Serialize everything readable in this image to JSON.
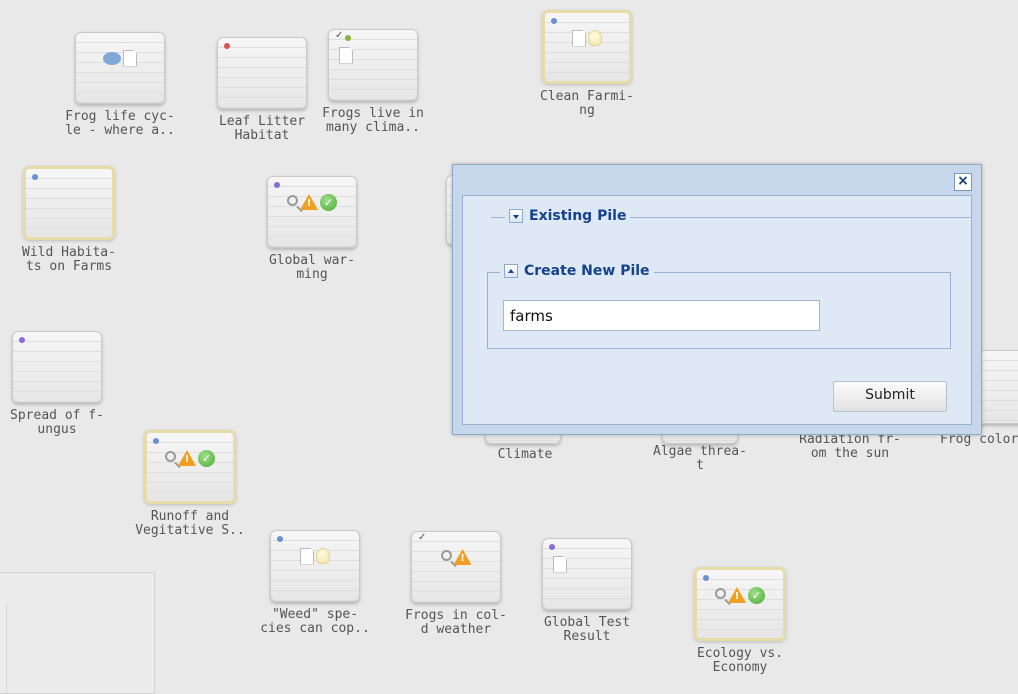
{
  "cards": [
    {
      "id": "frog-life",
      "label": "Frog life cyc-\nle - where a..",
      "highlighted": false,
      "dot": "",
      "check": false,
      "icons": [
        "speech-icon",
        "document-icon"
      ]
    },
    {
      "id": "leaf-litter",
      "label": "Leaf Litter\nHabitat",
      "highlighted": false,
      "dot": "#d9534f",
      "check": false,
      "icons": []
    },
    {
      "id": "frogs-live",
      "label": "Frogs live in\nmany clima..",
      "highlighted": false,
      "dot": "#8bb33a",
      "check": true,
      "icons": [
        "document-icon"
      ]
    },
    {
      "id": "clean-farming",
      "label": "Clean Farmi-\nng",
      "highlighted": true,
      "dot": "#6b8fd6",
      "check": false,
      "icons": [
        "document-icon",
        "lightbulb-icon"
      ]
    },
    {
      "id": "wild-habitats",
      "label": "Wild Habita-\nts on Farms",
      "highlighted": true,
      "dot": "#6b8fd6",
      "check": false,
      "icons": []
    },
    {
      "id": "global-warming",
      "label": "Global war-\nming",
      "highlighted": false,
      "dot": "#8b6bd6",
      "check": false,
      "icons": [
        "magnifier-icon",
        "warning-icon",
        "checkmark-icon"
      ]
    },
    {
      "id": "spread-fungus",
      "label": "Spread of f-\nungus",
      "highlighted": false,
      "dot": "#8b6bd6",
      "check": false,
      "icons": []
    },
    {
      "id": "runoff",
      "label": "Runoff and\nVegitative S..",
      "highlighted": true,
      "dot": "#6b8fd6",
      "check": false,
      "icons": [
        "magnifier-icon",
        "warning-icon",
        "checkmark-icon"
      ]
    },
    {
      "id": "weed-species",
      "label": "\"Weed\" spe-\ncies can cop..",
      "highlighted": false,
      "dot": "#6b8fd6",
      "check": false,
      "icons": [
        "document-icon",
        "lightbulb-icon"
      ]
    },
    {
      "id": "frogs-cold",
      "label": "Frogs in col-\nd weather",
      "highlighted": false,
      "dot": "",
      "check": true,
      "icons": [
        "magnifier-icon",
        "warning-icon"
      ]
    },
    {
      "id": "global-test",
      "label": "Global Test\nResult",
      "highlighted": false,
      "dot": "#8b6bd6",
      "check": false,
      "icons": [
        "document-icon"
      ]
    },
    {
      "id": "ecology-economy",
      "label": "Ecology vs.\nEconomy",
      "highlighted": true,
      "dot": "#6b8fd6",
      "check": false,
      "icons": [
        "magnifier-icon",
        "warning-icon",
        "checkmark-icon"
      ]
    }
  ],
  "partial_labels": {
    "climate": "Climate",
    "algae": "Algae threa-\nt",
    "radiation": "Radiation fr-\nom the sun",
    "frog_color": "Frog color"
  },
  "dialog": {
    "close_label": "×",
    "existing_pile": "Existing Pile",
    "create_new_pile": "Create New Pile",
    "input_value": "farms",
    "submit_label": "Submit"
  }
}
